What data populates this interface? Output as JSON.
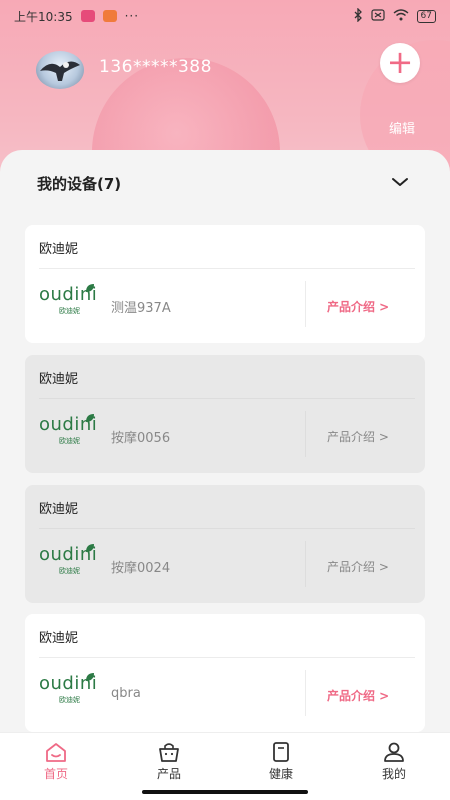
{
  "status_bar": {
    "time": "上午10:35",
    "more": "···",
    "battery": "67"
  },
  "profile": {
    "phone": "136*****388",
    "add_label": "+",
    "edit_label": "编辑"
  },
  "devices_section": {
    "title": "我的设备(7)"
  },
  "devices": [
    {
      "brand": "欧迪妮",
      "name": "测温937A",
      "intro": "产品介绍 >",
      "active": true
    },
    {
      "brand": "欧迪妮",
      "name": "按摩0056",
      "intro": "产品介绍 >",
      "active": false
    },
    {
      "brand": "欧迪妮",
      "name": "按摩0024",
      "intro": "产品介绍 >",
      "active": false
    },
    {
      "brand": "欧迪妮",
      "name": "qbra",
      "intro": "产品介绍 >",
      "active": true
    }
  ],
  "logo": {
    "word": "oudini",
    "sub": "欧迪妮"
  },
  "tabs": [
    {
      "label": "首页",
      "icon": "home-icon",
      "active": true
    },
    {
      "label": "产品",
      "icon": "shopping-bag-icon",
      "active": false
    },
    {
      "label": "健康",
      "icon": "book-icon",
      "active": false
    },
    {
      "label": "我的",
      "icon": "user-icon",
      "active": false
    }
  ],
  "colors": {
    "accent": "#ef6a86",
    "header_pink": "#f6b7c1",
    "logo_green": "#2c7a45"
  }
}
